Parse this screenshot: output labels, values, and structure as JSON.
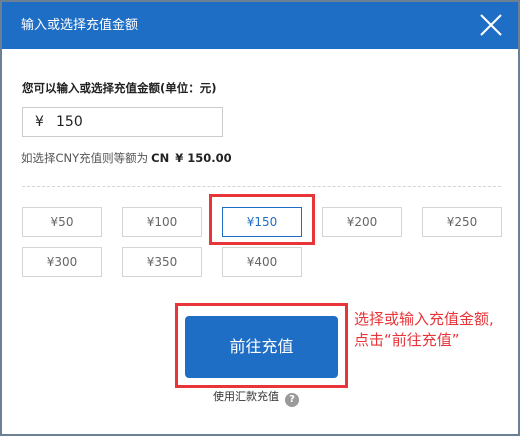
{
  "dialog": {
    "title": "输入或选择充值金额",
    "colors": {
      "title_bar": "#1f6ec5",
      "accent": "#1f6ec5",
      "highlight": "#e8353a"
    },
    "close_icon": "close-icon"
  },
  "form": {
    "prompt": "您可以输入或选择充值金额(单位：元)",
    "currency_symbol": "¥",
    "amount_value": "150",
    "equivalent_prefix": "如选择CNY充值则等额为",
    "equivalent_currency": "CN",
    "equivalent_amount": "¥ 150.00"
  },
  "options": [
    {
      "label": "¥50",
      "selected": false
    },
    {
      "label": "¥100",
      "selected": false
    },
    {
      "label": "¥150",
      "selected": true
    },
    {
      "label": "¥200",
      "selected": false
    },
    {
      "label": "¥250",
      "selected": false
    },
    {
      "label": "¥300",
      "selected": false
    },
    {
      "label": "¥350",
      "selected": false
    },
    {
      "label": "¥400",
      "selected": false
    }
  ],
  "actions": {
    "submit_label": "前往充值",
    "remit_label": "使用汇款充值",
    "help_icon": "help-icon",
    "help_glyph": "?"
  },
  "annotation": {
    "line1": "选择或输入充值金额,",
    "line2": "点击“前往充值”"
  }
}
